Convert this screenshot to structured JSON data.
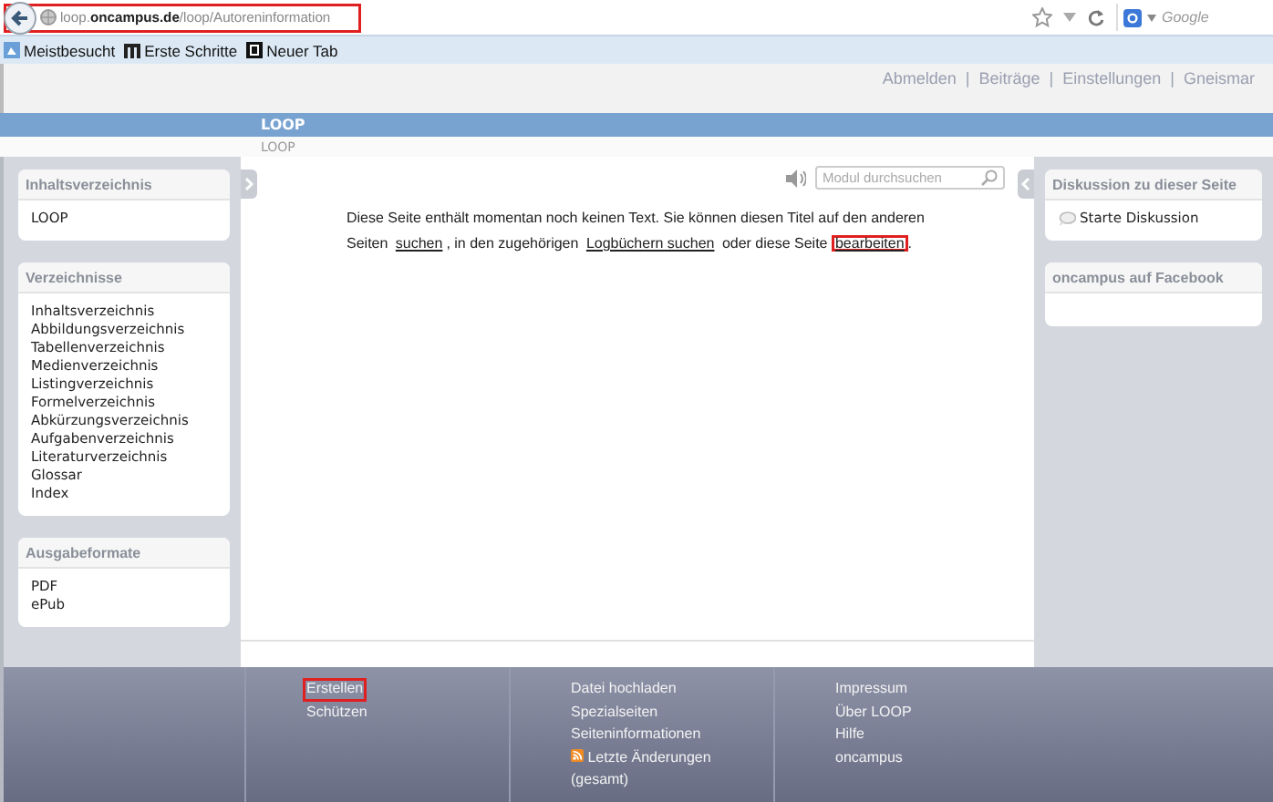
{
  "browser": {
    "url": "loop.**oncampus.de**/loop/Autoreninformation",
    "highlighted": true,
    "search_placeholder": "Google"
  },
  "bookmarks": [
    "Meistbesucht",
    "Erste Schritte",
    "Neuer Tab"
  ],
  "user_links": [
    "Abmelden",
    "Beiträge",
    "Einstellungen",
    "Gneismar"
  ],
  "user_links_separator": "|",
  "banner": {
    "title": "LOOP"
  },
  "breadcrumb": "LOOP",
  "left_panels": [
    {
      "title": "Inhaltsverzeichnis",
      "items": [
        "LOOP"
      ]
    },
    {
      "title": "Verzeichnisse",
      "items": [
        "Inhaltsverzeichnis",
        "Abbildungsverzeichnis",
        "Tabellenverzeichnis",
        "Medienverzeichnis",
        "Listingverzeichnis",
        "Formelverzeichnis",
        "Abkürzungsverzeichnis",
        "Aufgabenverzeichnis",
        "Literaturverzeichnis",
        "Glossar",
        "Index"
      ]
    },
    {
      "title": "Ausgabeformate",
      "items": [
        "PDF",
        "ePub"
      ]
    }
  ],
  "search": {
    "placeholder": "Modul durchsuchen"
  },
  "content": [
    {
      "kind": "text",
      "text": "Diese Seite enthält momentan noch keinen Text. Sie können diesen Titel auf den anderen Seiten "
    },
    {
      "kind": "link",
      "text": "suchen",
      "highlighted": false
    },
    {
      "kind": "text",
      "text": ", in den zugehörigen "
    },
    {
      "kind": "link",
      "text": "Logbüchern suchen",
      "highlighted": false
    },
    {
      "kind": "text",
      "text": " oder diese Seite "
    },
    {
      "kind": "link",
      "text": "bearbeiten",
      "highlighted": true
    },
    {
      "kind": "text",
      "text": "."
    }
  ],
  "right_panels": [
    {
      "title": "Diskussion zu dieser Seite",
      "items": [
        "Starte Diskussion"
      ]
    },
    {
      "title": "oncampus auf Facebook"
    }
  ],
  "footer": [
    [
      {
        "label": "Erstellen",
        "kind": "link",
        "highlighted": true
      },
      {
        "label": "Schützen",
        "kind": "link",
        "highlighted": false
      }
    ],
    [
      {
        "label": "Datei hochladen",
        "kind": "link",
        "highlighted": false
      },
      {
        "label": "Spezialseiten",
        "kind": "link",
        "highlighted": false
      },
      {
        "label": "Seiteninformationen",
        "kind": "link",
        "highlighted": false
      },
      {
        "label": "Letzte Änderungen (gesamt)",
        "kind": "feed",
        "highlighted": false
      }
    ],
    [
      {
        "label": "Impressum",
        "kind": "link",
        "highlighted": false
      },
      {
        "label": "Über LOOP",
        "kind": "link",
        "highlighted": false
      },
      {
        "label": "Hilfe",
        "kind": "link",
        "highlighted": false
      },
      {
        "label": "oncampus",
        "kind": "link",
        "highlighted": false
      }
    ]
  ]
}
